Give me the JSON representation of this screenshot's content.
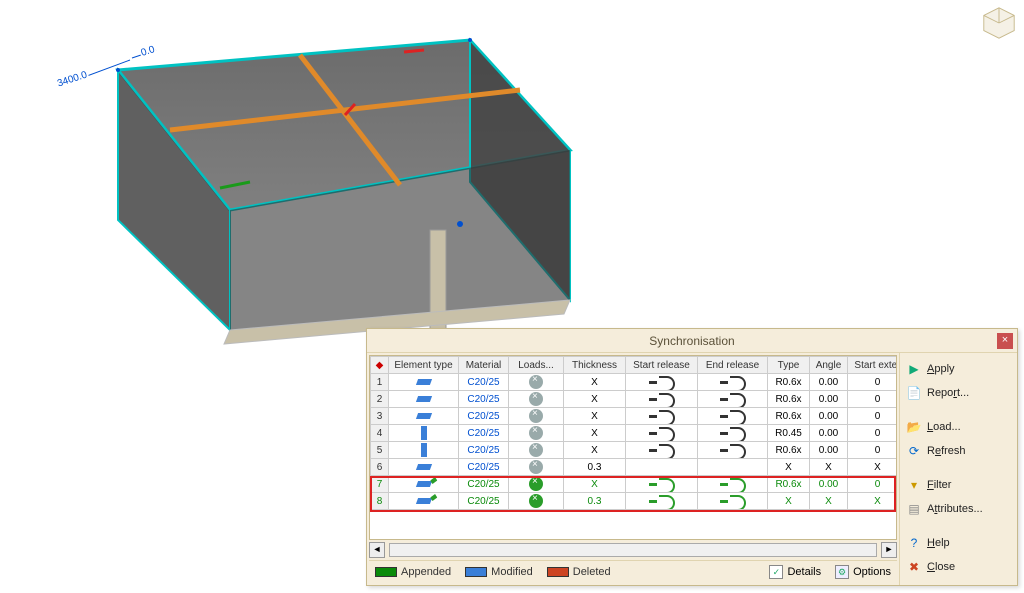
{
  "model": {
    "dim_a": "3400.0",
    "dim_b": "0.0"
  },
  "dialog": {
    "title": "Synchronisation"
  },
  "grid": {
    "headers": {
      "rowmark": "◆",
      "element_type": "Element type",
      "material": "Material",
      "loads": "Loads...",
      "thickness": "Thickness",
      "start_release": "Start release",
      "end_release": "End release",
      "type": "Type",
      "angle": "Angle",
      "start_exter": "Start exter"
    },
    "rows": [
      {
        "n": "1",
        "elem": "beam",
        "material": "C20/25",
        "loads": "x",
        "thickness": "X",
        "srel": "ro",
        "erel": "ro",
        "type": "R0.6x",
        "angle": "0.00",
        "se": "0",
        "status": "mod"
      },
      {
        "n": "2",
        "elem": "beam",
        "material": "C20/25",
        "loads": "x",
        "thickness": "X",
        "srel": "ro",
        "erel": "ro",
        "type": "R0.6x",
        "angle": "0.00",
        "se": "0",
        "status": "mod"
      },
      {
        "n": "3",
        "elem": "beam",
        "material": "C20/25",
        "loads": "x",
        "thickness": "X",
        "srel": "ro",
        "erel": "ro",
        "type": "R0.6x",
        "angle": "0.00",
        "se": "0",
        "status": "mod"
      },
      {
        "n": "4",
        "elem": "col",
        "material": "C20/25",
        "loads": "x",
        "thickness": "X",
        "srel": "ro",
        "erel": "ro",
        "type": "R0.45",
        "angle": "0.00",
        "se": "0",
        "status": "mod"
      },
      {
        "n": "5",
        "elem": "col",
        "material": "C20/25",
        "loads": "x",
        "thickness": "X",
        "srel": "ro",
        "erel": "ro",
        "type": "R0.6x",
        "angle": "0.00",
        "se": "0",
        "status": "mod"
      },
      {
        "n": "6",
        "elem": "plate",
        "material": "C20/25",
        "loads": "x",
        "thickness": "0.3",
        "srel": "",
        "erel": "",
        "type": "X",
        "angle": "X",
        "se": "X",
        "status": "mod"
      },
      {
        "n": "7",
        "elem": "beam",
        "material": "C20/25",
        "loads": "g",
        "thickness": "X",
        "srel": "ga",
        "erel": "ga",
        "type": "R0.6x",
        "angle": "0.00",
        "se": "0",
        "status": "app"
      },
      {
        "n": "8",
        "elem": "plate",
        "material": "C20/25",
        "loads": "g",
        "thickness": "0.3",
        "srel": "gx",
        "erel": "gx",
        "type": "X",
        "angle": "X",
        "se": "X",
        "status": "app"
      }
    ]
  },
  "legend": {
    "appended": "Appended",
    "modified": "Modified",
    "deleted": "Deleted",
    "details": "Details",
    "options": "Options"
  },
  "side": {
    "apply": "Apply",
    "report": "Report...",
    "load": "Load...",
    "refresh": "Refresh",
    "filter": "Filter",
    "attributes": "Attributes...",
    "help": "Help",
    "close": "Close"
  }
}
